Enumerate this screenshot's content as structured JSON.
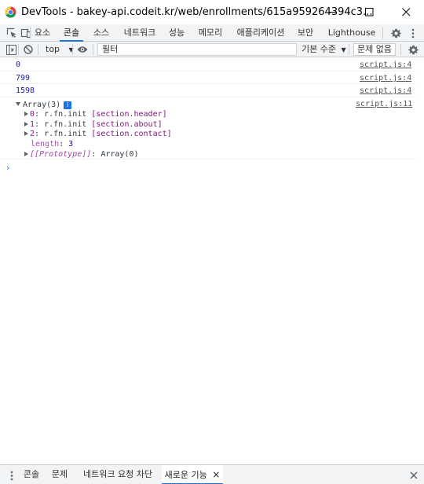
{
  "window": {
    "title": "DevTools - bakey-api.codeit.kr/web/enrollments/615a959264394c3..."
  },
  "tabs": [
    {
      "label": "요소"
    },
    {
      "label": "콘솔"
    },
    {
      "label": "소스"
    },
    {
      "label": "네트워크"
    },
    {
      "label": "성능"
    },
    {
      "label": "메모리"
    },
    {
      "label": "애플리케이션"
    },
    {
      "label": "보안"
    },
    {
      "label": "Lighthouse"
    }
  ],
  "active_tab": "콘솔",
  "toolbar": {
    "context": "top",
    "filter_placeholder": "필터",
    "levels": "기본 수준",
    "issues": "문제 없음"
  },
  "console": {
    "messages": [
      {
        "value": "0",
        "source": "script.js:4"
      },
      {
        "value": "799",
        "source": "script.js:4"
      },
      {
        "value": "1598",
        "source": "script.js:4"
      }
    ],
    "array_log": {
      "header": "Array(3)",
      "info": "i",
      "source": "script.js:11",
      "items": [
        {
          "index": "0",
          "sep": ": ",
          "ctor": "r.fn.init ",
          "selector": "[section.header]"
        },
        {
          "index": "1",
          "sep": ": ",
          "ctor": "r.fn.init ",
          "selector": "[section.about]"
        },
        {
          "index": "2",
          "sep": ": ",
          "ctor": "r.fn.init ",
          "selector": "[section.contact]"
        }
      ],
      "length_key": "length",
      "length_sep": ": ",
      "length_value": "3",
      "proto_key": "[[Prototype]]",
      "proto_sep": ": ",
      "proto_value": "Array(0)"
    },
    "prompt": "›"
  },
  "drawer": {
    "tabs": [
      {
        "label": "콘솔"
      },
      {
        "label": "문제"
      },
      {
        "label": "네트워크 요청 차단"
      },
      {
        "label": "새로운 기능"
      }
    ],
    "active_tab": "새로운 기능",
    "close": "×"
  },
  "colors": {
    "accent": "#1a73e8",
    "toolbar_bg": "#f1f3f4",
    "log_number": "#1a1aa6"
  }
}
